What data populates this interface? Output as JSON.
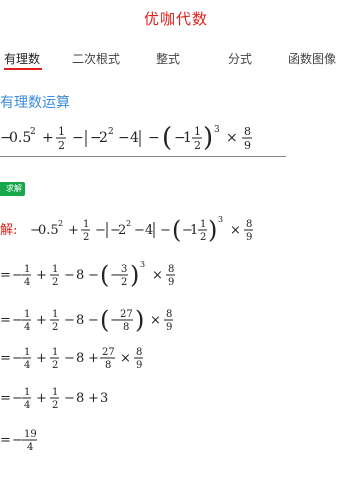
{
  "app": {
    "title": "优咖代数"
  },
  "tabs": [
    {
      "label": "有理数",
      "active": true
    },
    {
      "label": "二次根式"
    },
    {
      "label": "整式"
    },
    {
      "label": "分式"
    },
    {
      "label": "函数图像"
    }
  ],
  "section": {
    "title": "有理数运算"
  },
  "solve_button": {
    "label": "求解"
  },
  "solution": {
    "label": "解:"
  },
  "math": {
    "n1": "1",
    "n2": "2",
    "n3": "3",
    "n4": "4",
    "n8": "8",
    "n9": "9",
    "n19": "19",
    "n27": "27",
    "n05": "0.5",
    "sq": "2",
    "cube": "3",
    "plus": "+",
    "minus": "−",
    "times": "×",
    "eq": "="
  }
}
